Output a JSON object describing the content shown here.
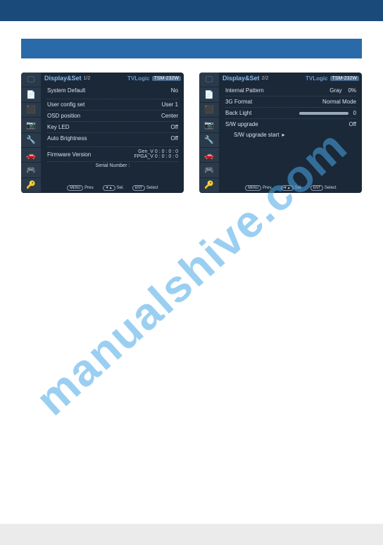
{
  "watermark": "manualshive.com",
  "screen1": {
    "header": {
      "title": "Display&Set",
      "page": "1/2",
      "brand": "TVLogic",
      "model": "TSM-232W"
    },
    "rows": {
      "system_default": {
        "label": "System Default",
        "value": "No"
      },
      "user_config": {
        "label": "User config set",
        "value": "User 1"
      },
      "osd_position": {
        "label": "OSD position",
        "value": "Center"
      },
      "key_led": {
        "label": "Key LED",
        "value": "Off"
      },
      "auto_brightness": {
        "label": "Auto Brightness",
        "value": "Off"
      },
      "firmware": {
        "label": "Firmware Version",
        "line1": "Gen_V 0 : 0 : 0 : 0",
        "line2": "FPGA_V 0 : 0 : 0 : 0"
      },
      "serial": {
        "label": "Serial Number :"
      }
    },
    "footer": {
      "prev_btn": "MENU",
      "prev": "Prev.",
      "sel_btn": "▼▲",
      "sel": "Sel.",
      "select_btn": "ENT",
      "select": "Select"
    }
  },
  "screen2": {
    "header": {
      "title": "Display&Set",
      "page": "2/2",
      "brand": "TVLogic",
      "model": "TSM-232W"
    },
    "rows": {
      "internal_pattern": {
        "label": "Internal Pattern",
        "value": "Gray",
        "pct": "0%"
      },
      "three_g": {
        "label": "3G Format",
        "value": "Normal Mode"
      },
      "back_light": {
        "label": "Back Light",
        "value": "0"
      },
      "sw_upgrade": {
        "label": "S/W upgrade",
        "value": "Off"
      },
      "sw_start": {
        "label": "S/W upgrade start"
      }
    },
    "footer": {
      "prev_btn": "MENU",
      "prev": "Prev.",
      "sel_btn": "▼▲",
      "sel": "Sel.",
      "select_btn": "ENT",
      "select": "Select"
    }
  },
  "icons": {
    "i1": "🖵",
    "i2": "📄",
    "i3": "⬛",
    "i4": "📷",
    "i5": "🔧",
    "i6": "🚗",
    "i7": "🎮",
    "i8": "🔑"
  }
}
